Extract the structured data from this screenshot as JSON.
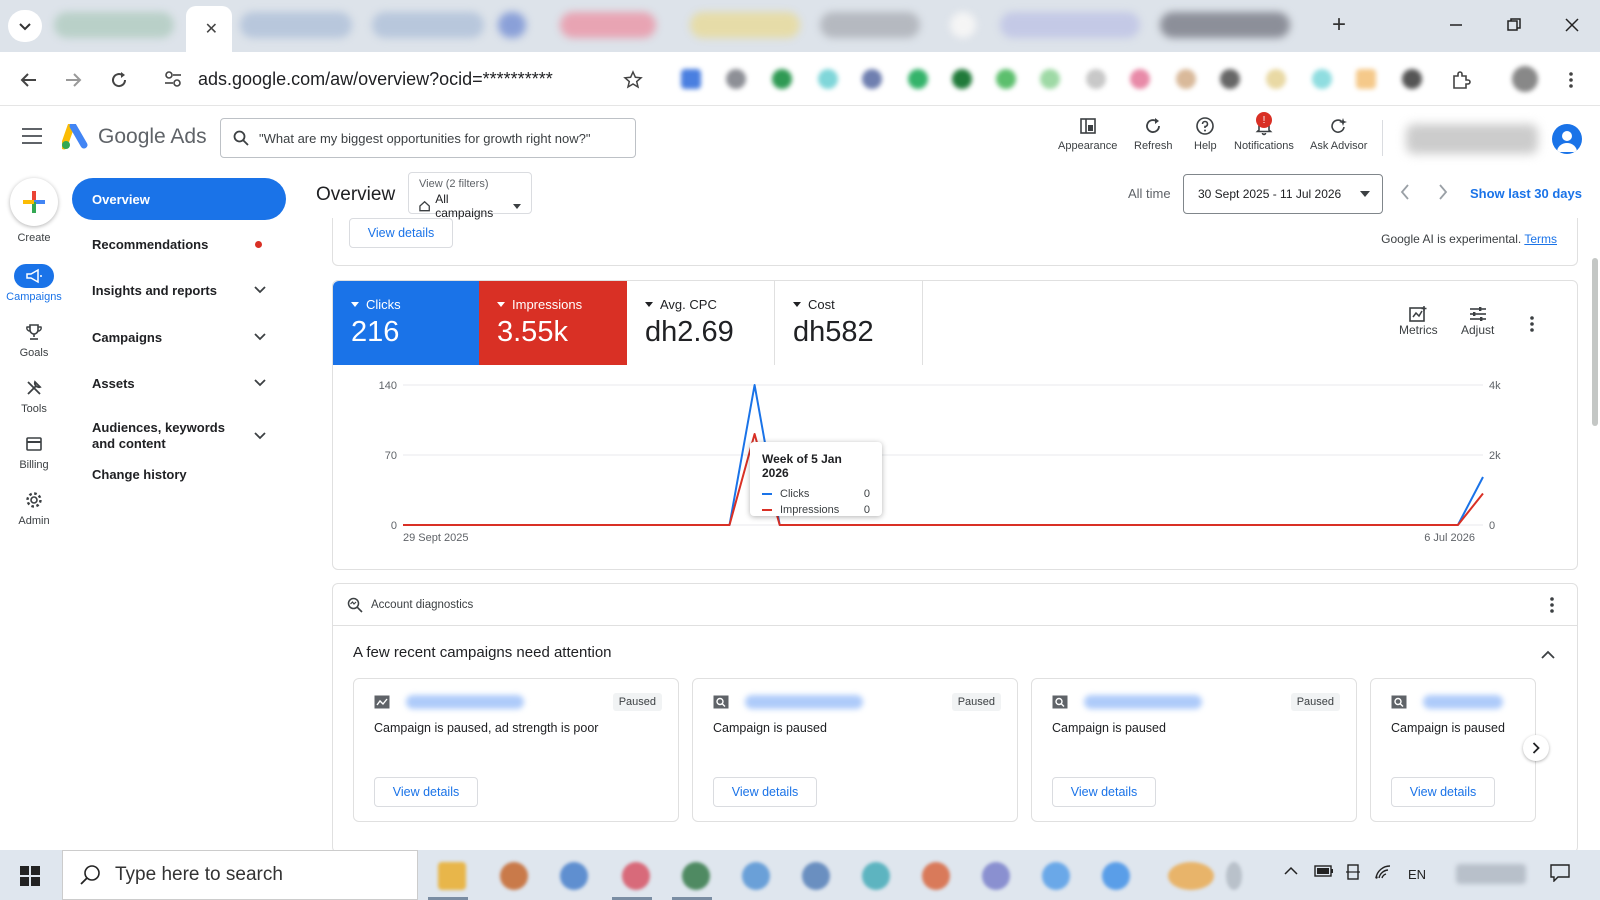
{
  "browser": {
    "active_tab_close": "✕",
    "new_tab": "+",
    "url": "ads.google.com/aw/overview?ocid=**********"
  },
  "header": {
    "product": "Google Ads",
    "search_placeholder": "\"What are my biggest opportunities for growth right now?\"",
    "tools": [
      {
        "label": "Appearance",
        "icon": "appearance-icon"
      },
      {
        "label": "Refresh",
        "icon": "refresh-icon"
      },
      {
        "label": "Help",
        "icon": "help-icon"
      },
      {
        "label": "Notifications",
        "icon": "bell-icon",
        "badge": "!"
      },
      {
        "label": "Ask Advisor",
        "icon": "advisor-icon"
      }
    ]
  },
  "rail": {
    "create": "Create",
    "items": [
      {
        "label": "Campaigns",
        "icon": "megaphone-icon",
        "active": true
      },
      {
        "label": "Goals",
        "icon": "trophy-icon"
      },
      {
        "label": "Tools",
        "icon": "tools-icon"
      },
      {
        "label": "Billing",
        "icon": "billing-icon"
      },
      {
        "label": "Admin",
        "icon": "gear-icon"
      }
    ]
  },
  "sidenav": {
    "items": [
      {
        "label": "Overview",
        "active": true
      },
      {
        "label": "Recommendations",
        "dot": true
      },
      {
        "label": "Insights and reports",
        "expandable": true
      },
      {
        "label": "Campaigns",
        "expandable": true
      },
      {
        "label": "Assets",
        "expandable": true
      },
      {
        "label": "Audiences, keywords and content",
        "expandable": true
      },
      {
        "label": "Change history"
      }
    ]
  },
  "overview": {
    "title": "Overview",
    "view_filter_top": "View (2 filters)",
    "view_filter_value": "All campaigns",
    "date_label": "All time",
    "date_range": "30 Sept 2025 - 11 Jul 2026",
    "show_last": "Show last 30 days",
    "view_details": "View details",
    "ai_note": "Google AI is experimental.",
    "ai_terms": "Terms"
  },
  "metrics": [
    {
      "label": "Clicks",
      "value": "216",
      "style": "blue"
    },
    {
      "label": "Impressions",
      "value": "3.55k",
      "style": "red"
    },
    {
      "label": "Avg. CPC",
      "value": "dh2.69",
      "style": "plain"
    },
    {
      "label": "Cost",
      "value": "dh582",
      "style": "plain"
    }
  ],
  "chart_tools": {
    "metrics": "Metrics",
    "adjust": "Adjust"
  },
  "chart_data": {
    "type": "line",
    "x_start_label": "29 Sept 2025",
    "x_end_label": "6 Jul 2026",
    "y_left_ticks": [
      "140",
      "70",
      "0"
    ],
    "y_right_ticks": [
      "4k",
      "2k",
      "0"
    ],
    "ylim_left": [
      0,
      140
    ],
    "ylim_right": [
      0,
      4000
    ],
    "series": [
      {
        "name": "Clicks",
        "color": "#1a73e8",
        "axis": "left",
        "values": [
          0,
          0,
          0,
          0,
          0,
          0,
          0,
          0,
          0,
          0,
          0,
          0,
          0,
          0,
          140,
          0,
          0,
          0,
          0,
          0,
          0,
          0,
          0,
          0,
          0,
          0,
          0,
          0,
          0,
          0,
          0,
          0,
          0,
          0,
          0,
          0,
          0,
          0,
          0,
          0,
          0,
          0,
          0,
          48
        ]
      },
      {
        "name": "Impressions",
        "color": "#d93025",
        "axis": "right",
        "values": [
          0,
          0,
          0,
          0,
          0,
          0,
          0,
          0,
          0,
          0,
          0,
          0,
          0,
          0,
          2600,
          0,
          0,
          0,
          0,
          0,
          0,
          0,
          0,
          0,
          0,
          0,
          0,
          0,
          0,
          0,
          0,
          0,
          0,
          0,
          0,
          0,
          0,
          0,
          0,
          0,
          0,
          0,
          0,
          900
        ]
      }
    ],
    "tooltip": {
      "title": "Week of 5 Jan 2026",
      "rows": [
        {
          "name": "Clicks",
          "value": "0"
        },
        {
          "name": "Impressions",
          "value": "0"
        }
      ]
    }
  },
  "diagnostics": {
    "header": "Account diagnostics",
    "title": "A few recent campaigns need attention",
    "cards": [
      {
        "type_icon": "display-campaign-icon",
        "status": "Paused",
        "message": "Campaign is paused, ad strength is poor",
        "action": "View details"
      },
      {
        "type_icon": "search-campaign-icon",
        "status": "Paused",
        "message": "Campaign is paused",
        "action": "View details"
      },
      {
        "type_icon": "search-campaign-icon",
        "status": "Paused",
        "message": "Campaign is paused",
        "action": "View details"
      },
      {
        "type_icon": "search-campaign-icon",
        "status": "",
        "message": "Campaign is paused",
        "action": "View details"
      }
    ]
  },
  "taskbar": {
    "search_placeholder": "Type here to search",
    "language": "EN"
  }
}
